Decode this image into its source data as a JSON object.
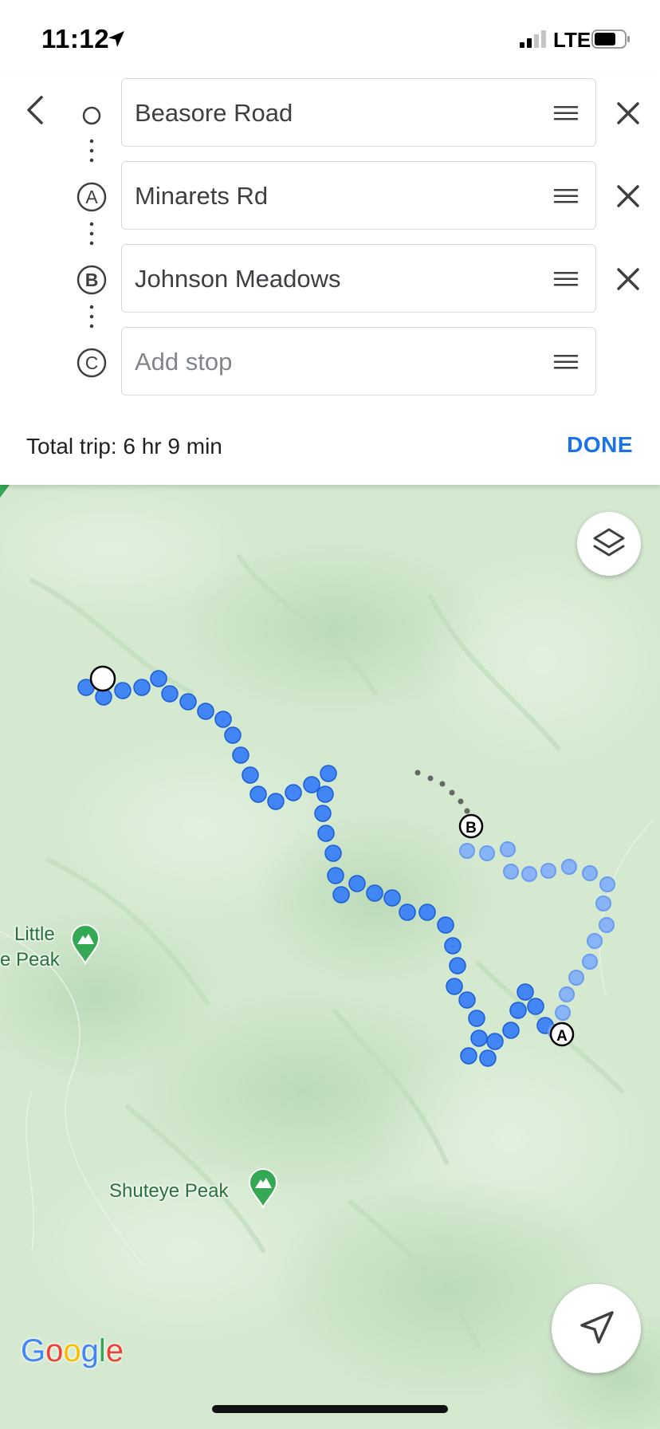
{
  "status_bar": {
    "time": "11:12",
    "network": "LTE"
  },
  "directions": {
    "stops": [
      {
        "marker": "",
        "value": "Beasore Road",
        "placeholder": ""
      },
      {
        "marker": "A",
        "value": "Minarets Rd",
        "placeholder": ""
      },
      {
        "marker": "B",
        "value": "Johnson Meadows",
        "placeholder": ""
      },
      {
        "marker": "C",
        "value": "",
        "placeholder": "Add stop"
      }
    ],
    "total_trip": "Total trip: 6 hr 9 min",
    "done_label": "DONE"
  },
  "map": {
    "route_markers": {
      "a": "A",
      "b": "B"
    },
    "peaks": [
      {
        "label_line1": "Little",
        "label_line2": "e Peak"
      },
      {
        "label": "Shuteye Peak"
      }
    ],
    "logo": [
      "G",
      "o",
      "o",
      "g",
      "l",
      "e"
    ],
    "colors": {
      "route_primary": "#4285f4",
      "route_alternate": "#8ab4f8",
      "accent": "#1a73e8",
      "terrain": "#d4e9d0",
      "peak_pin": "#34a853"
    },
    "icons": [
      "layers-icon",
      "navigation-arrow-icon",
      "mountain-pin-icon"
    ]
  }
}
